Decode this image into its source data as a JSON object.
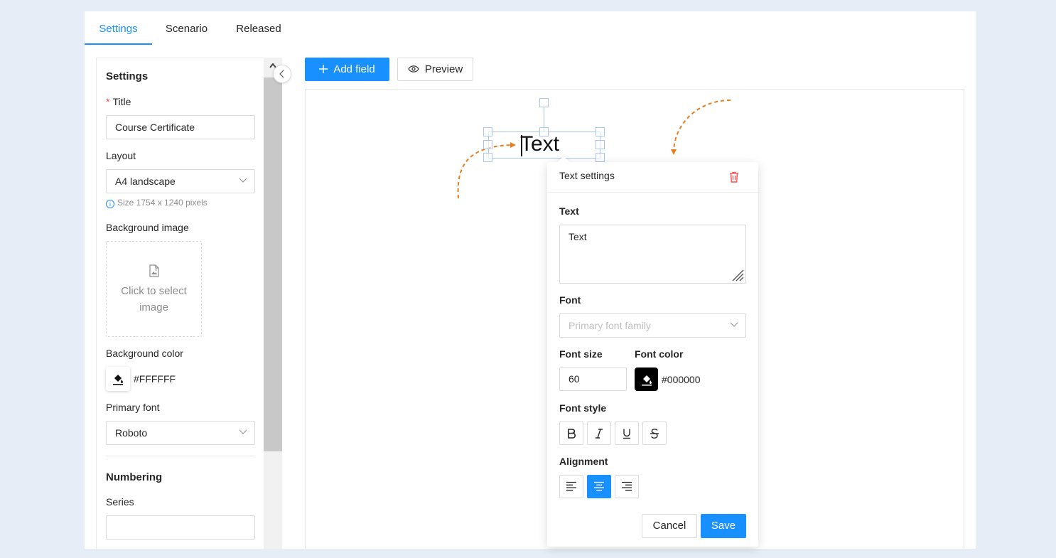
{
  "tabs": [
    {
      "label": "Settings",
      "active": true
    },
    {
      "label": "Scenario",
      "active": false
    },
    {
      "label": "Released",
      "active": false
    }
  ],
  "settings": {
    "heading": "Settings",
    "title_label": "Title",
    "title_required_mark": "*",
    "title_value": "Course Certificate",
    "layout_label": "Layout",
    "layout_value": "A4 landscape",
    "size_hint": "Size 1754 x 1240 pixels",
    "bg_image_label": "Background image",
    "bg_image_placeholder": "Click to select image",
    "bg_color_label": "Background color",
    "bg_color_value": "#FFFFFF",
    "primary_font_label": "Primary font",
    "primary_font_value": "Roboto",
    "numbering_heading": "Numbering",
    "series_label": "Series",
    "series_value": ""
  },
  "toolbar": {
    "add_field_label": "Add field",
    "preview_label": "Preview"
  },
  "canvas": {
    "field_text": "Text"
  },
  "text_settings": {
    "title": "Text settings",
    "text_label": "Text",
    "text_value": "Text",
    "font_label": "Font",
    "font_placeholder": "Primary font family",
    "font_size_label": "Font size",
    "font_size_value": "60",
    "font_color_label": "Font color",
    "font_color_value": "#000000",
    "font_style_label": "Font style",
    "alignment_label": "Alignment",
    "alignment_selected": "center",
    "cancel_label": "Cancel",
    "save_label": "Save"
  },
  "colors": {
    "accent": "#1890ff",
    "guide_arrow": "#e87d1e",
    "delete": "#ff4d4f"
  }
}
